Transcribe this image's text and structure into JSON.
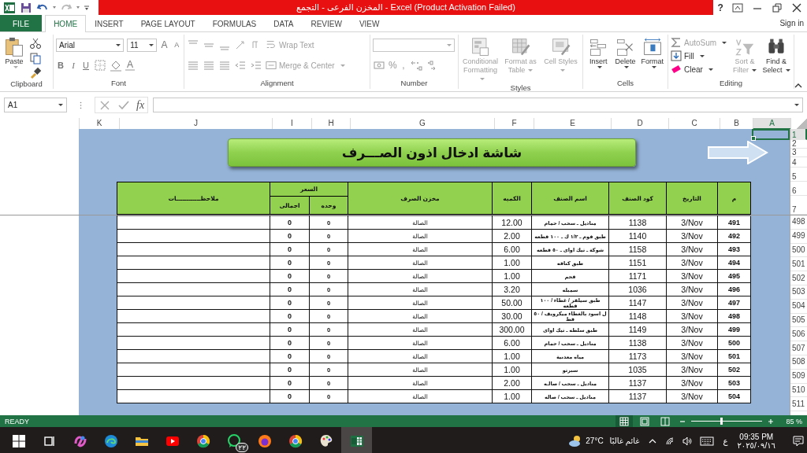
{
  "title_bar": {
    "title": "المخزن الفرعى - التجمع - Excel (Product Activation Failed)",
    "help": "?"
  },
  "ribbon": {
    "tabs": [
      {
        "label": "FILE",
        "kind": "file",
        "selected": false
      },
      {
        "label": "HOME",
        "kind": "tab",
        "selected": true
      },
      {
        "label": "INSERT",
        "kind": "tab",
        "selected": false
      },
      {
        "label": "PAGE LAYOUT",
        "kind": "tab",
        "selected": false
      },
      {
        "label": "FORMULAS",
        "kind": "tab",
        "selected": false
      },
      {
        "label": "DATA",
        "kind": "tab",
        "selected": false
      },
      {
        "label": "REVIEW",
        "kind": "tab",
        "selected": false
      },
      {
        "label": "VIEW",
        "kind": "tab",
        "selected": false
      }
    ],
    "sign_in": "Sign in",
    "clipboard": {
      "label": "Clipboard",
      "paste": "Paste"
    },
    "font": {
      "label": "Font",
      "font_name": "Arial",
      "font_size": "11",
      "letter_buttons": [
        {
          "label": "A",
          "kind": "grow"
        },
        {
          "label": "A",
          "kind": "shrink"
        },
        {
          "label": "B",
          "kind": "bold"
        },
        {
          "label": "I",
          "kind": "italic"
        },
        {
          "label": "U",
          "kind": "underline"
        },
        {
          "label": "A",
          "kind": "color"
        }
      ]
    },
    "alignment": {
      "label": "Alignment",
      "wrap_text": {
        "label": "Wrap Text",
        "disabled": true
      },
      "merge_center": {
        "label": "Merge & Center",
        "disabled": true
      }
    },
    "number": {
      "label": "Number",
      "symbols": [
        "%",
        ","
      ]
    },
    "styles": {
      "label": "Styles",
      "buttons": [
        {
          "label": "Conditional Formatting",
          "kind": "conditional",
          "disabled": true
        },
        {
          "label": "Format as Table",
          "kind": "table",
          "disabled": true
        },
        {
          "label": "Cell Styles",
          "kind": "styles",
          "disabled": true
        }
      ]
    },
    "cells": {
      "label": "Cells",
      "buttons": [
        {
          "label": "Insert",
          "kind": "insert",
          "disabled": false
        },
        {
          "label": "Delete",
          "kind": "delete",
          "disabled": false
        },
        {
          "label": "Format",
          "kind": "format",
          "disabled": false
        }
      ]
    },
    "editing": {
      "label": "Editing",
      "small_buttons": [
        {
          "label": "AutoSum",
          "kind": "sum",
          "disabled": true
        },
        {
          "label": "Fill",
          "kind": "fill",
          "disabled": false
        },
        {
          "label": "Clear",
          "kind": "clear",
          "disabled": false
        }
      ],
      "large_buttons": [
        {
          "label": "Sort & Filter",
          "kind": "sort",
          "disabled": true
        },
        {
          "label": "Find & Select",
          "kind": "find",
          "disabled": false
        }
      ]
    }
  },
  "formula_bar": {
    "name_box": "A1",
    "fx": "fx"
  },
  "sheet": {
    "columns": [
      {
        "label": "K",
        "selected": false
      },
      {
        "label": "J",
        "selected": false
      },
      {
        "label": "I",
        "selected": false
      },
      {
        "label": "H",
        "selected": false
      },
      {
        "label": "G",
        "selected": false
      },
      {
        "label": "F",
        "selected": false
      },
      {
        "label": "E",
        "selected": false
      },
      {
        "label": "D",
        "selected": false
      },
      {
        "label": "C",
        "selected": false
      },
      {
        "label": "B",
        "selected": false
      },
      {
        "label": "A",
        "selected": true
      }
    ],
    "frozen_rows": [
      {
        "label": "1",
        "selected": true
      },
      {
        "label": "2",
        "selected": false
      },
      {
        "label": "3",
        "selected": false
      },
      {
        "label": "4",
        "selected": false
      },
      {
        "label": "5",
        "selected": false
      },
      {
        "label": "6",
        "selected": false
      },
      {
        "label": "7",
        "selected": false
      }
    ],
    "rows": [
      {
        "label": "498",
        "selected": false
      },
      {
        "label": "499",
        "selected": false
      },
      {
        "label": "500",
        "selected": false
      },
      {
        "label": "501",
        "selected": false
      },
      {
        "label": "502",
        "selected": false
      },
      {
        "label": "503",
        "selected": false
      },
      {
        "label": "504",
        "selected": false
      },
      {
        "label": "505",
        "selected": false
      },
      {
        "label": "506",
        "selected": false
      },
      {
        "label": "507",
        "selected": false
      },
      {
        "label": "508",
        "selected": false
      },
      {
        "label": "509",
        "selected": false
      },
      {
        "label": "510",
        "selected": false
      },
      {
        "label": "511",
        "selected": false
      }
    ]
  },
  "form": {
    "title": "شاشة ادخال اذون الصـــرف",
    "columns": [
      "م",
      "التاريخ",
      "كود الصنف",
      "اسم الصنف",
      "الكميه",
      "مخزن الصرف"
    ],
    "price_group": {
      "label": "السعر",
      "sub": [
        "وحده",
        "اجمالى"
      ]
    },
    "notes": "ملاحظــــــــــــات",
    "rows": [
      {
        "no": "491",
        "date": "3/Nov",
        "code": "1138",
        "item": "مناديل ـ سحب / حمام",
        "qty": "12.00",
        "store": "الصالة",
        "unit": "0",
        "total": "0"
      },
      {
        "no": "492",
        "date": "3/Nov",
        "code": "1140",
        "item": "طبق فوم ـ ١/٢ ك ـ ١٠٠ قطعه",
        "qty": "2.00",
        "store": "الصالة",
        "unit": "0",
        "total": "0"
      },
      {
        "no": "493",
        "date": "3/Nov",
        "code": "1158",
        "item": "شوكة ـ تيك اواى ـ ٥٠ قطعه",
        "qty": "6.00",
        "store": "الصالة",
        "unit": "0",
        "total": "0"
      },
      {
        "no": "494",
        "date": "3/Nov",
        "code": "1151",
        "item": "طبق كنافه",
        "qty": "1.00",
        "store": "الصالة",
        "unit": "0",
        "total": "0"
      },
      {
        "no": "495",
        "date": "3/Nov",
        "code": "1171",
        "item": "فحم",
        "qty": "1.00",
        "store": "الصالة",
        "unit": "0",
        "total": "0"
      },
      {
        "no": "496",
        "date": "3/Nov",
        "code": "1036",
        "item": "سمبله",
        "qty": "3.20",
        "store": "الصالة",
        "unit": "0",
        "total": "0"
      },
      {
        "no": "497",
        "date": "3/Nov",
        "code": "1147",
        "item": "طبق سيلفر / غطاء / ١٠٠ قطعه",
        "qty": "50.00",
        "store": "الصالة",
        "unit": "0",
        "total": "0"
      },
      {
        "no": "498",
        "date": "3/Nov",
        "code": "1148",
        "item": "ل اسود بالغطاء ميكرويف / ٥٠ قط",
        "qty": "30.00",
        "store": "الصالة",
        "unit": "0",
        "total": "0"
      },
      {
        "no": "499",
        "date": "3/Nov",
        "code": "1149",
        "item": "طبق سلطه ـ تيك اواى",
        "qty": "300.00",
        "store": "الصالة",
        "unit": "0",
        "total": "0"
      },
      {
        "no": "500",
        "date": "3/Nov",
        "code": "1138",
        "item": "مناديل ـ سحب / حمام",
        "qty": "6.00",
        "store": "الصالة",
        "unit": "0",
        "total": "0"
      },
      {
        "no": "501",
        "date": "3/Nov",
        "code": "1173",
        "item": "مياه معدنية",
        "qty": "1.00",
        "store": "الصالة",
        "unit": "0",
        "total": "0"
      },
      {
        "no": "502",
        "date": "3/Nov",
        "code": "1035",
        "item": "سبرتو",
        "qty": "1.00",
        "store": "الصالة",
        "unit": "0",
        "total": "0"
      },
      {
        "no": "503",
        "date": "3/Nov",
        "code": "1137",
        "item": "مناديل ـ سحب / صالـه",
        "qty": "2.00",
        "store": "الصالة",
        "unit": "0",
        "total": "0"
      },
      {
        "no": "504",
        "date": "3/Nov",
        "code": "1137",
        "item": "مناديل ـ سحب / صاله",
        "qty": "1.00",
        "store": "الصالة",
        "unit": "0",
        "total": "0"
      }
    ]
  },
  "status_bar": {
    "status": "READY",
    "views": [
      {
        "kind": "normal",
        "selected": true
      },
      {
        "kind": "layout",
        "selected": false
      },
      {
        "kind": "break",
        "selected": false
      }
    ],
    "zoom": {
      "level": 0.42,
      "label": "85 %"
    }
  },
  "taskbar": {
    "apps": [
      {
        "kind": "start",
        "active": false
      },
      {
        "kind": "taskview",
        "active": false
      },
      {
        "kind": "swirl",
        "active": false
      },
      {
        "kind": "wave",
        "active": false
      },
      {
        "kind": "folder",
        "active": false
      },
      {
        "kind": "play",
        "active": false
      },
      {
        "kind": "ring",
        "active": false
      },
      {
        "kind": "chat",
        "active": false,
        "badge": "٢٢"
      },
      {
        "kind": "flame",
        "active": false
      },
      {
        "kind": "ring",
        "active": false
      },
      {
        "kind": "palette",
        "active": false
      },
      {
        "kind": "sheet",
        "active": true
      }
    ],
    "temperature": "27°C",
    "weather": "غائم غالبًا",
    "language": "ع",
    "time": "09:35 PM",
    "date": "٢٠٢٥/٠٩/١٦"
  }
}
